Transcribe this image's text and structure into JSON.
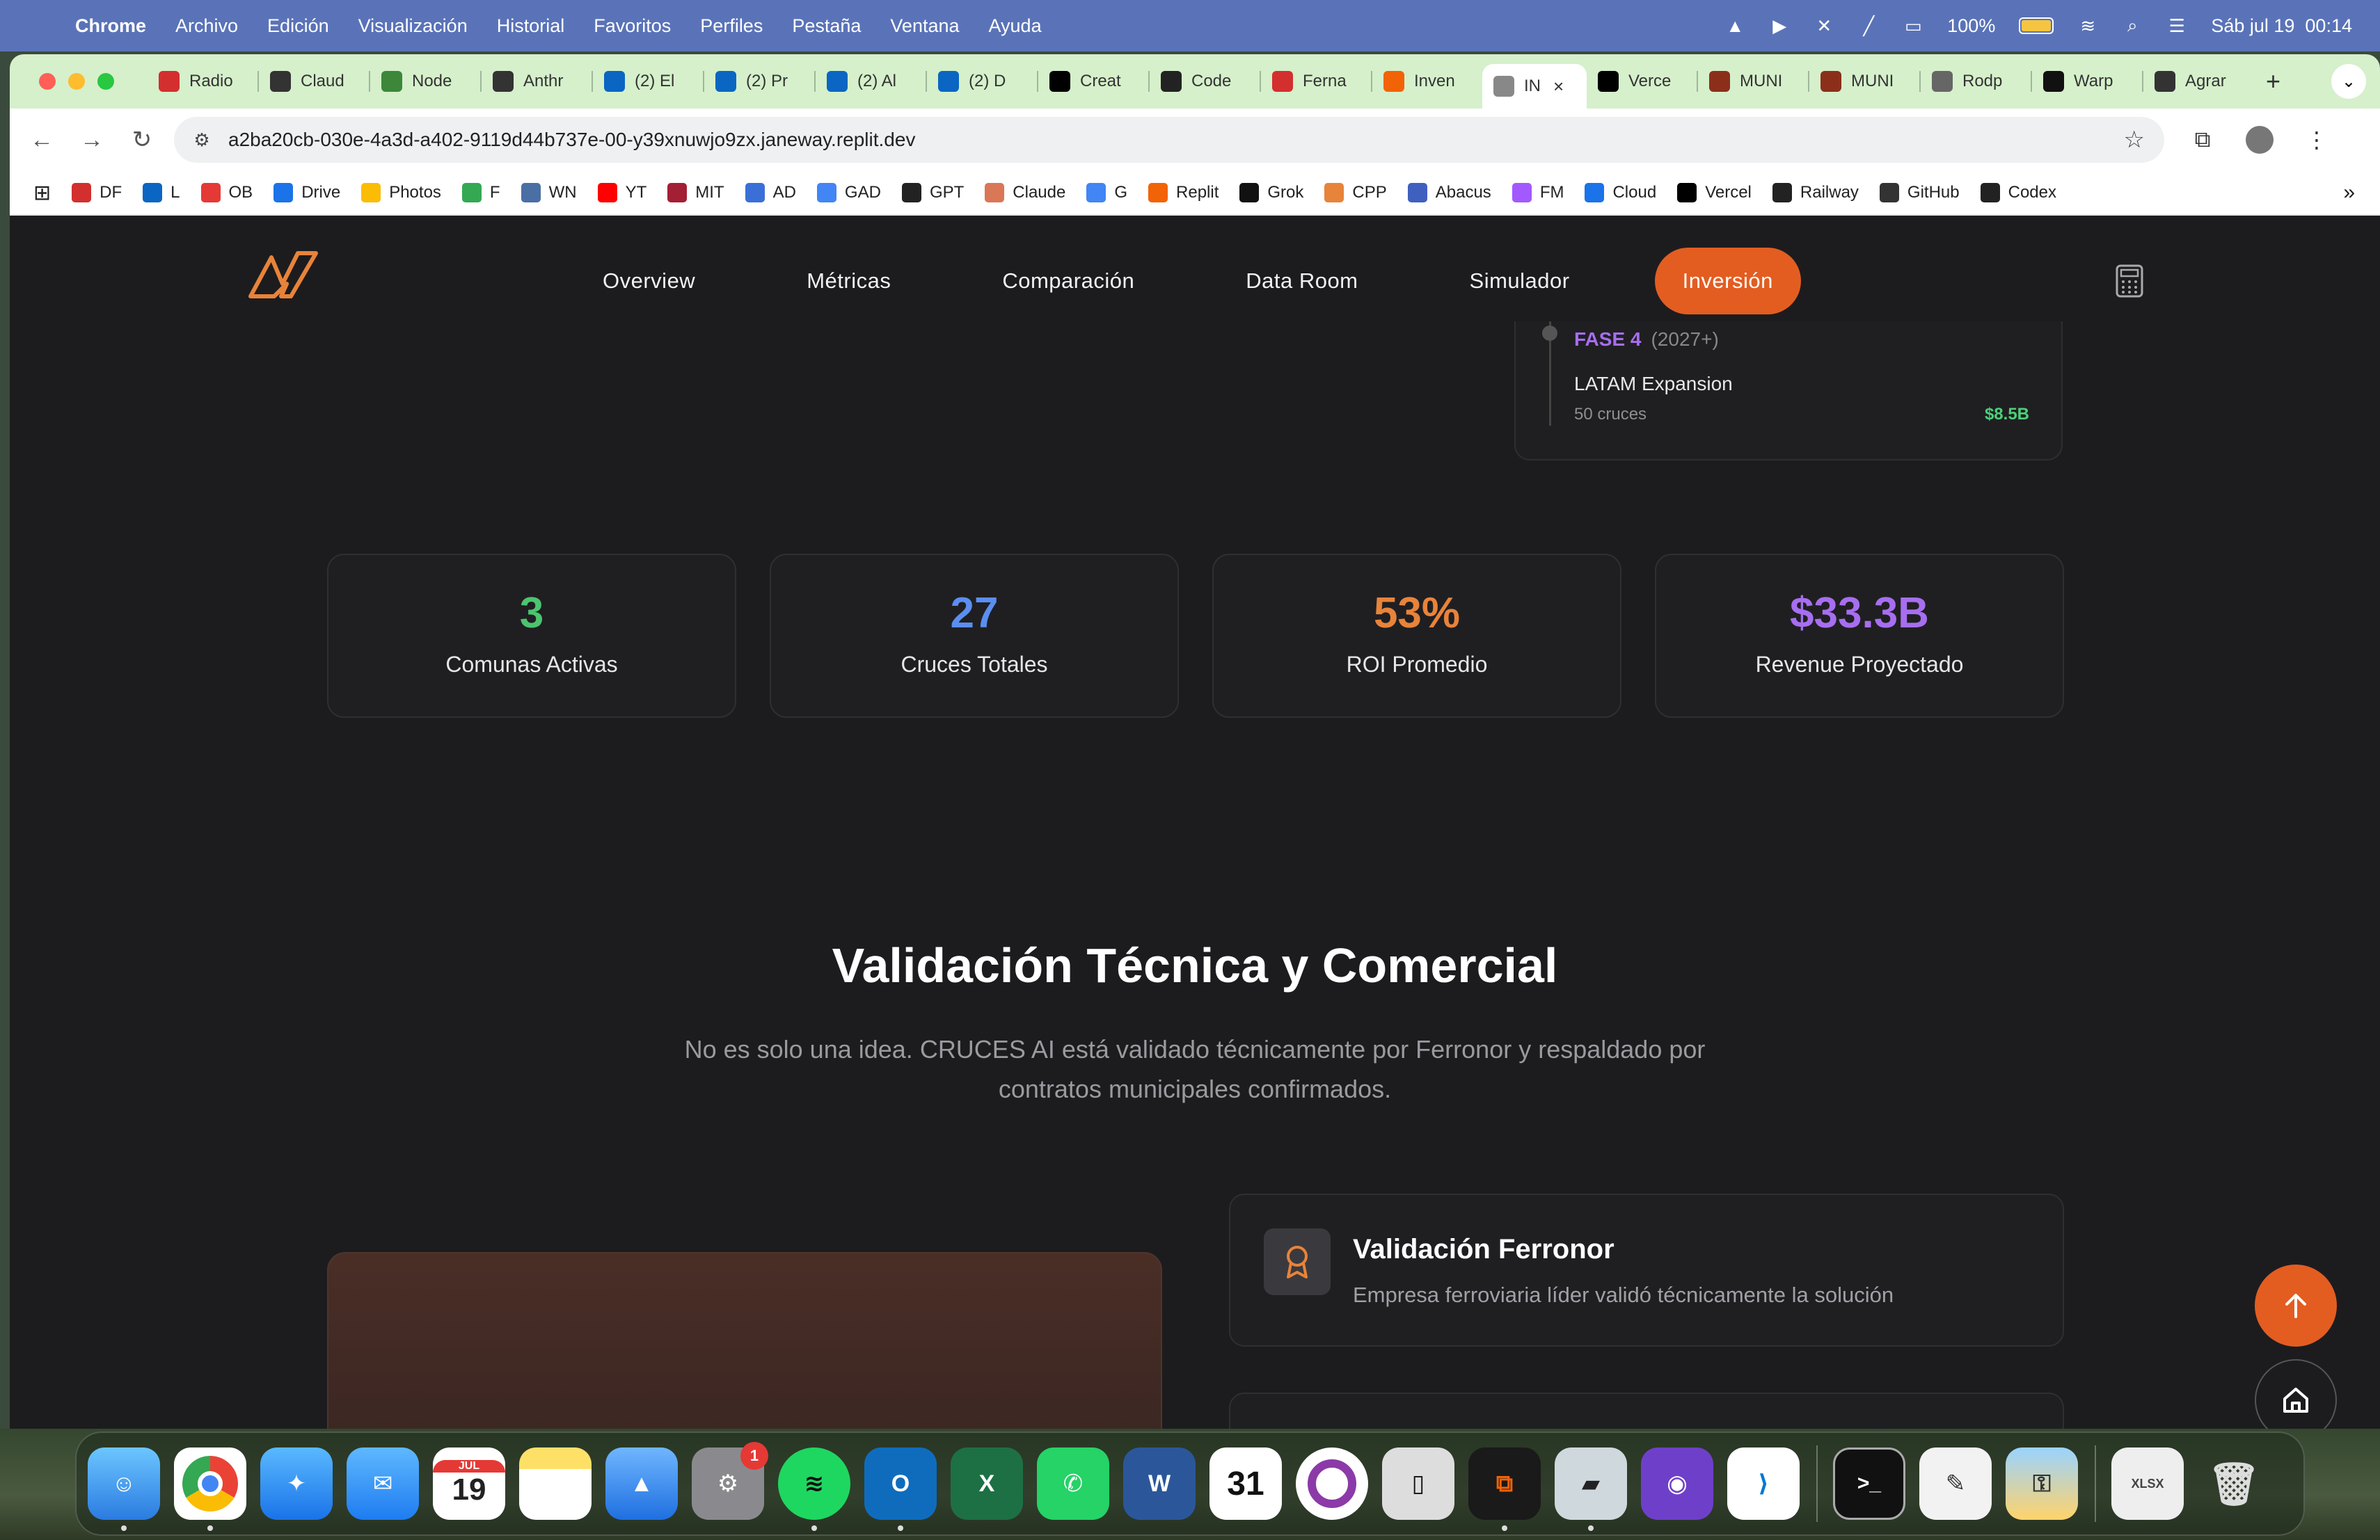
{
  "menubar": {
    "app": "Chrome",
    "items": [
      "Archivo",
      "Edición",
      "Visualización",
      "Historial",
      "Favoritos",
      "Perfiles",
      "Pestaña",
      "Ventana",
      "Ayuda"
    ],
    "battery": "100%",
    "datetime": "Sáb jul 19  00:14"
  },
  "tabs": [
    {
      "label": "Radio",
      "icon": "df-icon"
    },
    {
      "label": "Claud",
      "icon": "anthropic-icon"
    },
    {
      "label": "Node",
      "icon": "node-icon"
    },
    {
      "label": "Anthr",
      "icon": "anthropic-icon"
    },
    {
      "label": "(2) El",
      "icon": "linkedin-icon"
    },
    {
      "label": "(2) Pr",
      "icon": "linkedin-icon"
    },
    {
      "label": "(2) Al",
      "icon": "linkedin-icon"
    },
    {
      "label": "(2) D",
      "icon": "linkedin-icon"
    },
    {
      "label": "Creat",
      "icon": "v0-icon"
    },
    {
      "label": "Code",
      "icon": "codex-icon"
    },
    {
      "label": "Ferna",
      "icon": "df-icon"
    },
    {
      "label": "Inven",
      "icon": "replit-icon"
    },
    {
      "label": "IN",
      "icon": "globe-icon",
      "active": true
    },
    {
      "label": "Verce",
      "icon": "vercel-icon"
    },
    {
      "label": "MUNI",
      "icon": "muni-icon"
    },
    {
      "label": "MUNI",
      "icon": "muni-icon"
    },
    {
      "label": "Rodp",
      "icon": "github-icon"
    },
    {
      "label": "Warp",
      "icon": "warp-icon"
    },
    {
      "label": "Agrar",
      "icon": "openai-icon"
    }
  ],
  "url": "a2ba20cb-030e-4a3d-a402-9119d44b737e-00-y39xnuwjo9zx.janeway.replit.dev",
  "bookmarks": [
    "DF",
    "L",
    "OB",
    "Drive",
    "Photos",
    "F",
    "WN",
    "YT",
    "MIT",
    "AD",
    "GAD",
    "GPT",
    "Claude",
    "G",
    "Replit",
    "Grok",
    "CPP",
    "Abacus",
    "FM",
    "Cloud",
    "Vercel",
    "Railway",
    "GitHub",
    "Codex"
  ],
  "nav": {
    "links": [
      "Overview",
      "Métricas",
      "Comparación",
      "Data Room",
      "Simulador"
    ],
    "active": "Inversión"
  },
  "roadmap": {
    "phase": "FASE 4",
    "year": "(2027+)",
    "title": "LATAM Expansion",
    "sub": "50 cruces",
    "amount": "$8.5B"
  },
  "stats": [
    {
      "value": "3",
      "label": "Comunas Activas",
      "color": "#4cc46e"
    },
    {
      "value": "27",
      "label": "Cruces Totales",
      "color": "#5b8ef0"
    },
    {
      "value": "53%",
      "label": "ROI Promedio",
      "color": "#e8833a"
    },
    {
      "value": "$33.3B",
      "label": "Revenue Proyectado",
      "color": "#a76ef0"
    }
  ],
  "section": {
    "title": "Validación Técnica y Comercial",
    "subtitle": "No es solo una idea. CRUCES AI está validado técnicamente por Ferronor y respaldado por contratos municipales confirmados."
  },
  "validation": {
    "title": "Validación Ferronor",
    "desc": "Empresa ferroviaria líder validó técnicamente la solución"
  },
  "colors": {
    "accent": "#e35d21",
    "bg": "#1c1c1e"
  }
}
